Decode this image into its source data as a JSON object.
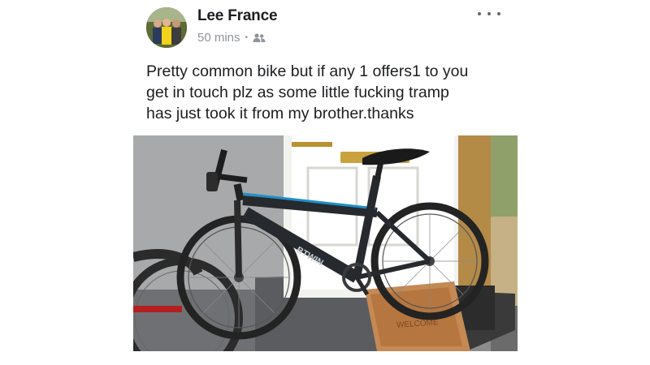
{
  "post": {
    "author": "Lee France",
    "time": "50 mins",
    "separator": "•",
    "audience_icon": "friends-icon",
    "more_icon": "more-options-icon",
    "text_lines": [
      "Pretty common bike but if any 1 offers1 to you",
      "get in touch plz as some little fucking tramp",
      "has just took it from my brother.thanks"
    ],
    "photo": {
      "frame_text": "BTWIN",
      "doormat_text": "WELCOME"
    }
  },
  "colors": {
    "name": "#1c1e21",
    "meta": "#90949c",
    "bike_accent": "#1e8fc6"
  }
}
